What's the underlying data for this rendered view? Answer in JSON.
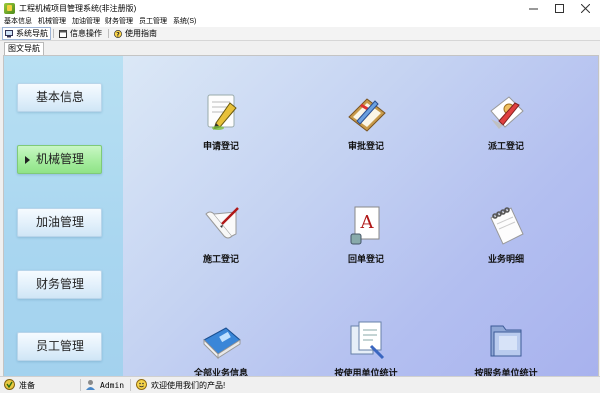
{
  "window": {
    "title": "工程机械项目管理系统(非注册版)",
    "minimize": "—",
    "maximize": "☐",
    "close": "✕"
  },
  "menu": [
    "基本信息",
    "机械管理",
    "加油管理",
    "财务管理",
    "员工管理",
    "系统(S)"
  ],
  "toolbar": {
    "items": [
      {
        "label": "系统导航",
        "icon": "monitor-icon",
        "active": true
      },
      {
        "label": "信息操作",
        "icon": "window-icon",
        "active": false
      },
      {
        "label": "使用指南",
        "icon": "help-icon",
        "active": false
      }
    ]
  },
  "tab": {
    "label": "图文导航"
  },
  "sidebar": {
    "items": [
      {
        "label": "基本信息",
        "active": false
      },
      {
        "label": "机械管理",
        "active": true
      },
      {
        "label": "加油管理",
        "active": false
      },
      {
        "label": "财务管理",
        "active": false
      },
      {
        "label": "员工管理",
        "active": false
      }
    ]
  },
  "functions": [
    {
      "label": "申请登记",
      "icon": "notepad-pen-icon"
    },
    {
      "label": "审批登记",
      "icon": "clipboard-pencil-icon"
    },
    {
      "label": "派工登记",
      "icon": "task-paper-icon"
    },
    {
      "label": "施工登记",
      "icon": "scroll-pen-icon"
    },
    {
      "label": "回单登记",
      "icon": "document-a-icon"
    },
    {
      "label": "业务明细",
      "icon": "spiral-notebook-icon"
    },
    {
      "label": "全部业务信息",
      "icon": "book-icon"
    },
    {
      "label": "按使用单位统计",
      "icon": "documents-icon"
    },
    {
      "label": "按服务单位统计",
      "icon": "folder-icon"
    }
  ],
  "status": {
    "ready": "准备",
    "user": "Admin",
    "message": "欢迎使用我们的产品!"
  },
  "colors": {
    "sidebar_bg": "#b8e0f3",
    "active_nav": "#a6ed9f",
    "content_bg": "#c4d2f2"
  }
}
